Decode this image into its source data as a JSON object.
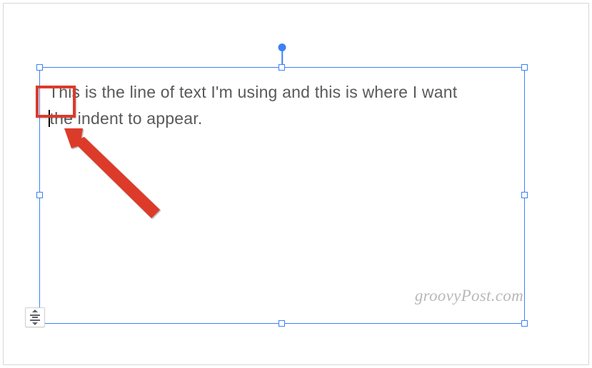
{
  "textbox": {
    "line1": "This is the line of text I'm using and this is where I want",
    "line2_prefix": "",
    "line2_rest": "the indent to appear."
  },
  "watermark": "groovyPost.com",
  "colors": {
    "selection": "#3b82f6",
    "annotation": "#dc3a2a",
    "body_text": "#595959"
  },
  "controls": {
    "valign_tooltip": "Align"
  }
}
